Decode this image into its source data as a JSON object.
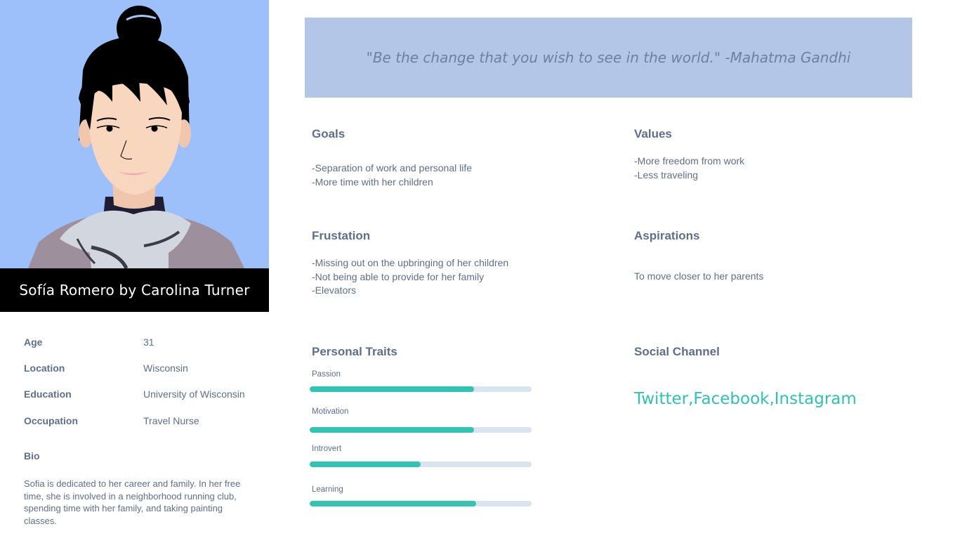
{
  "persona": {
    "name_bar": "Sofía Romero by Carolina Turner",
    "details": [
      {
        "label": "Age",
        "value": "31"
      },
      {
        "label": "Location",
        "value": "Wisconsin"
      },
      {
        "label": "Education",
        "value": "University of Wisconsin"
      },
      {
        "label": "Occupation",
        "value": "Travel Nurse"
      }
    ],
    "bio_label": "Bio",
    "bio_text": "Sofia is dedicated to her career and family. In her free time, she is involved in a neighborhood running club, spending time with her family, and taking painting classes."
  },
  "quote": "\"Be the change that you wish to see in the world.\" -Mahatma Gandhi",
  "goals": {
    "title": "Goals",
    "items": [
      "-Separation of work and personal life",
      "-More time with her children"
    ]
  },
  "values": {
    "title": "Values",
    "items": [
      "-More freedom from work",
      "-Less traveling"
    ]
  },
  "frustration": {
    "title": "Frustation",
    "items": [
      "-Missing out on the upbringing of her children",
      "-Not being able to provide for her family",
      "-Elevators"
    ]
  },
  "aspirations": {
    "title": "Aspirations",
    "items": [
      "To move closer to her parents"
    ]
  },
  "traits": {
    "title": "Personal Traits",
    "items": [
      {
        "label": "Passion",
        "level": 0.74
      },
      {
        "label": "Motivation",
        "level": 0.74
      },
      {
        "label": "Introvert",
        "level": 0.5
      },
      {
        "label": "Learning",
        "level": 0.75
      }
    ]
  },
  "social": {
    "title": "Social Channel",
    "channels": "Twitter,Facebook,Instagram"
  },
  "colors": {
    "portrait_bg": "#9dc0fb",
    "quote_bg": "#b3c6e7",
    "accent": "#32c4b2",
    "text": "#5f6e8c",
    "track": "#d9e4ee"
  }
}
